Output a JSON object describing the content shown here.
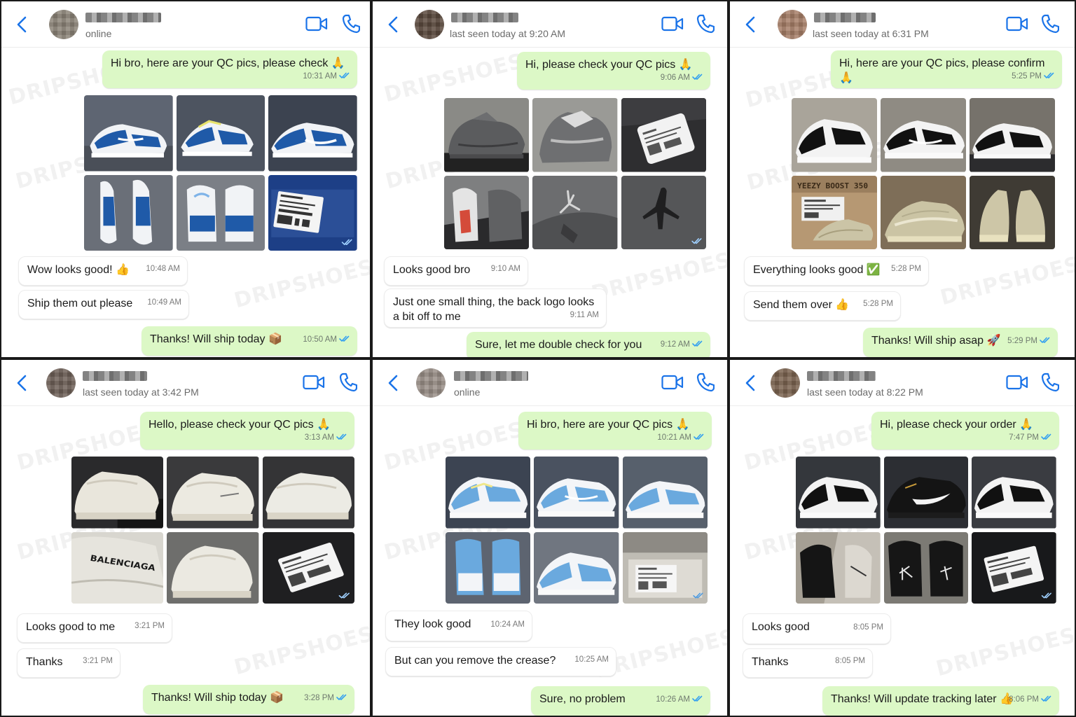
{
  "watermark": "DRIPSHOES",
  "colors": {
    "accent": "#1a73e8",
    "outgoing_bubble": "#dcf8c6",
    "incoming_bubble": "#ffffff",
    "read_ticks": "#34a0f0"
  },
  "icons": {
    "back": "chevron-left-icon",
    "video": "video-camera-icon",
    "call": "phone-icon",
    "read": "double-check-icon"
  },
  "panels": [
    {
      "status": "online",
      "messages": [
        {
          "dir": "out",
          "text": "Hi bro, here are your QC pics, please check 🙏",
          "time": "10:31 AM"
        },
        {
          "dir": "in",
          "text": "Wow looks good! 👍",
          "time": "10:48 AM"
        },
        {
          "dir": "in",
          "text": "Ship them out please",
          "time": "10:49 AM"
        },
        {
          "dir": "out",
          "text": "Thanks! Will ship today 📦",
          "time": "10:50 AM"
        }
      ],
      "photos": [
        "blue-white-dunk",
        "blue-white-dunk",
        "blue-white-dunk",
        "blue-white-dunk",
        "blue-white-dunk-heel",
        "box-label"
      ]
    },
    {
      "status": "last seen today at 9:20 AM",
      "messages": [
        {
          "dir": "out",
          "text": "Hi, please check your QC pics 🙏",
          "time": "9:06 AM"
        },
        {
          "dir": "in",
          "text": "Looks good bro",
          "time": "9:10 AM"
        },
        {
          "dir": "in",
          "text": "Just one small thing, the back logo looks a bit off to me",
          "time": "9:11 AM"
        },
        {
          "dir": "out",
          "text": "Sure, let me double check for you",
          "time": "9:12 AM"
        }
      ],
      "photos": [
        "grey-jordan-4",
        "grey-jordan-4",
        "box-label",
        "grey-jordan-4",
        "grey-jordan-4-closeup",
        "grey-jordan-4-closeup"
      ]
    },
    {
      "status": "last seen today at 6:31 PM",
      "messages": [
        {
          "dir": "out",
          "text": "Hi, here are your QC pics, please confirm 🙏",
          "time": "5:25 PM"
        },
        {
          "dir": "in",
          "text": "Everything looks good ✅",
          "time": "5:28 PM"
        },
        {
          "dir": "in",
          "text": "Send them over 👍",
          "time": "5:28 PM"
        },
        {
          "dir": "out",
          "text": "Thanks! Will ship asap 🚀",
          "time": "5:29 PM"
        }
      ],
      "photos": [
        "black-white-dunk",
        "black-white-dunk",
        "black-white-dunk",
        "yeezy-box",
        "yeezy-boost",
        "yeezy-boost"
      ],
      "box_text": "YEEZY BOOST 350"
    },
    {
      "status": "last seen today at 3:42 PM",
      "messages": [
        {
          "dir": "out",
          "text": "Hello, please check your QC pics 🙏",
          "time": "3:13 AM"
        },
        {
          "dir": "in",
          "text": "Looks good to me",
          "time": "3:21 PM"
        },
        {
          "dir": "in",
          "text": "Thanks",
          "time": "3:21 PM"
        },
        {
          "dir": "out",
          "text": "Thanks! Will ship today 📦",
          "time": "3:28 PM"
        }
      ],
      "photos": [
        "white-triple-s",
        "white-triple-s",
        "white-triple-s",
        "white-triple-s-logo",
        "white-triple-s",
        "box-label"
      ],
      "shoe_text": "BALENCIAGA"
    },
    {
      "status": "online",
      "messages": [
        {
          "dir": "out",
          "text": "Hi bro, here are your QC pics 🙏",
          "time": "10:21 AM"
        },
        {
          "dir": "in",
          "text": "They look good",
          "time": "10:24 AM"
        },
        {
          "dir": "in",
          "text": "But can you remove the crease?",
          "time": "10:25 AM"
        },
        {
          "dir": "out",
          "text": "Sure, no problem",
          "time": "10:26 AM"
        }
      ],
      "photos": [
        "light-blue-dunk",
        "light-blue-dunk",
        "light-blue-dunk",
        "light-blue-dunk-heel",
        "light-blue-dunk",
        "box-label"
      ]
    },
    {
      "status": "last seen today at 8:22 PM",
      "messages": [
        {
          "dir": "out",
          "text": "Hi, please check your order 🙏",
          "time": "7:47 PM"
        },
        {
          "dir": "in",
          "text": "Looks good",
          "time": "8:05 PM"
        },
        {
          "dir": "in",
          "text": "Thanks",
          "time": "8:05 PM"
        },
        {
          "dir": "out",
          "text": "Thanks! Will update tracking later 👍",
          "time": "8:06 PM"
        }
      ],
      "photos": [
        "black-white-dunk",
        "black-nike-sneaker",
        "black-white-dunk",
        "black-sneaker-inside",
        "black-sneaker-heel",
        "box-label"
      ]
    }
  ]
}
